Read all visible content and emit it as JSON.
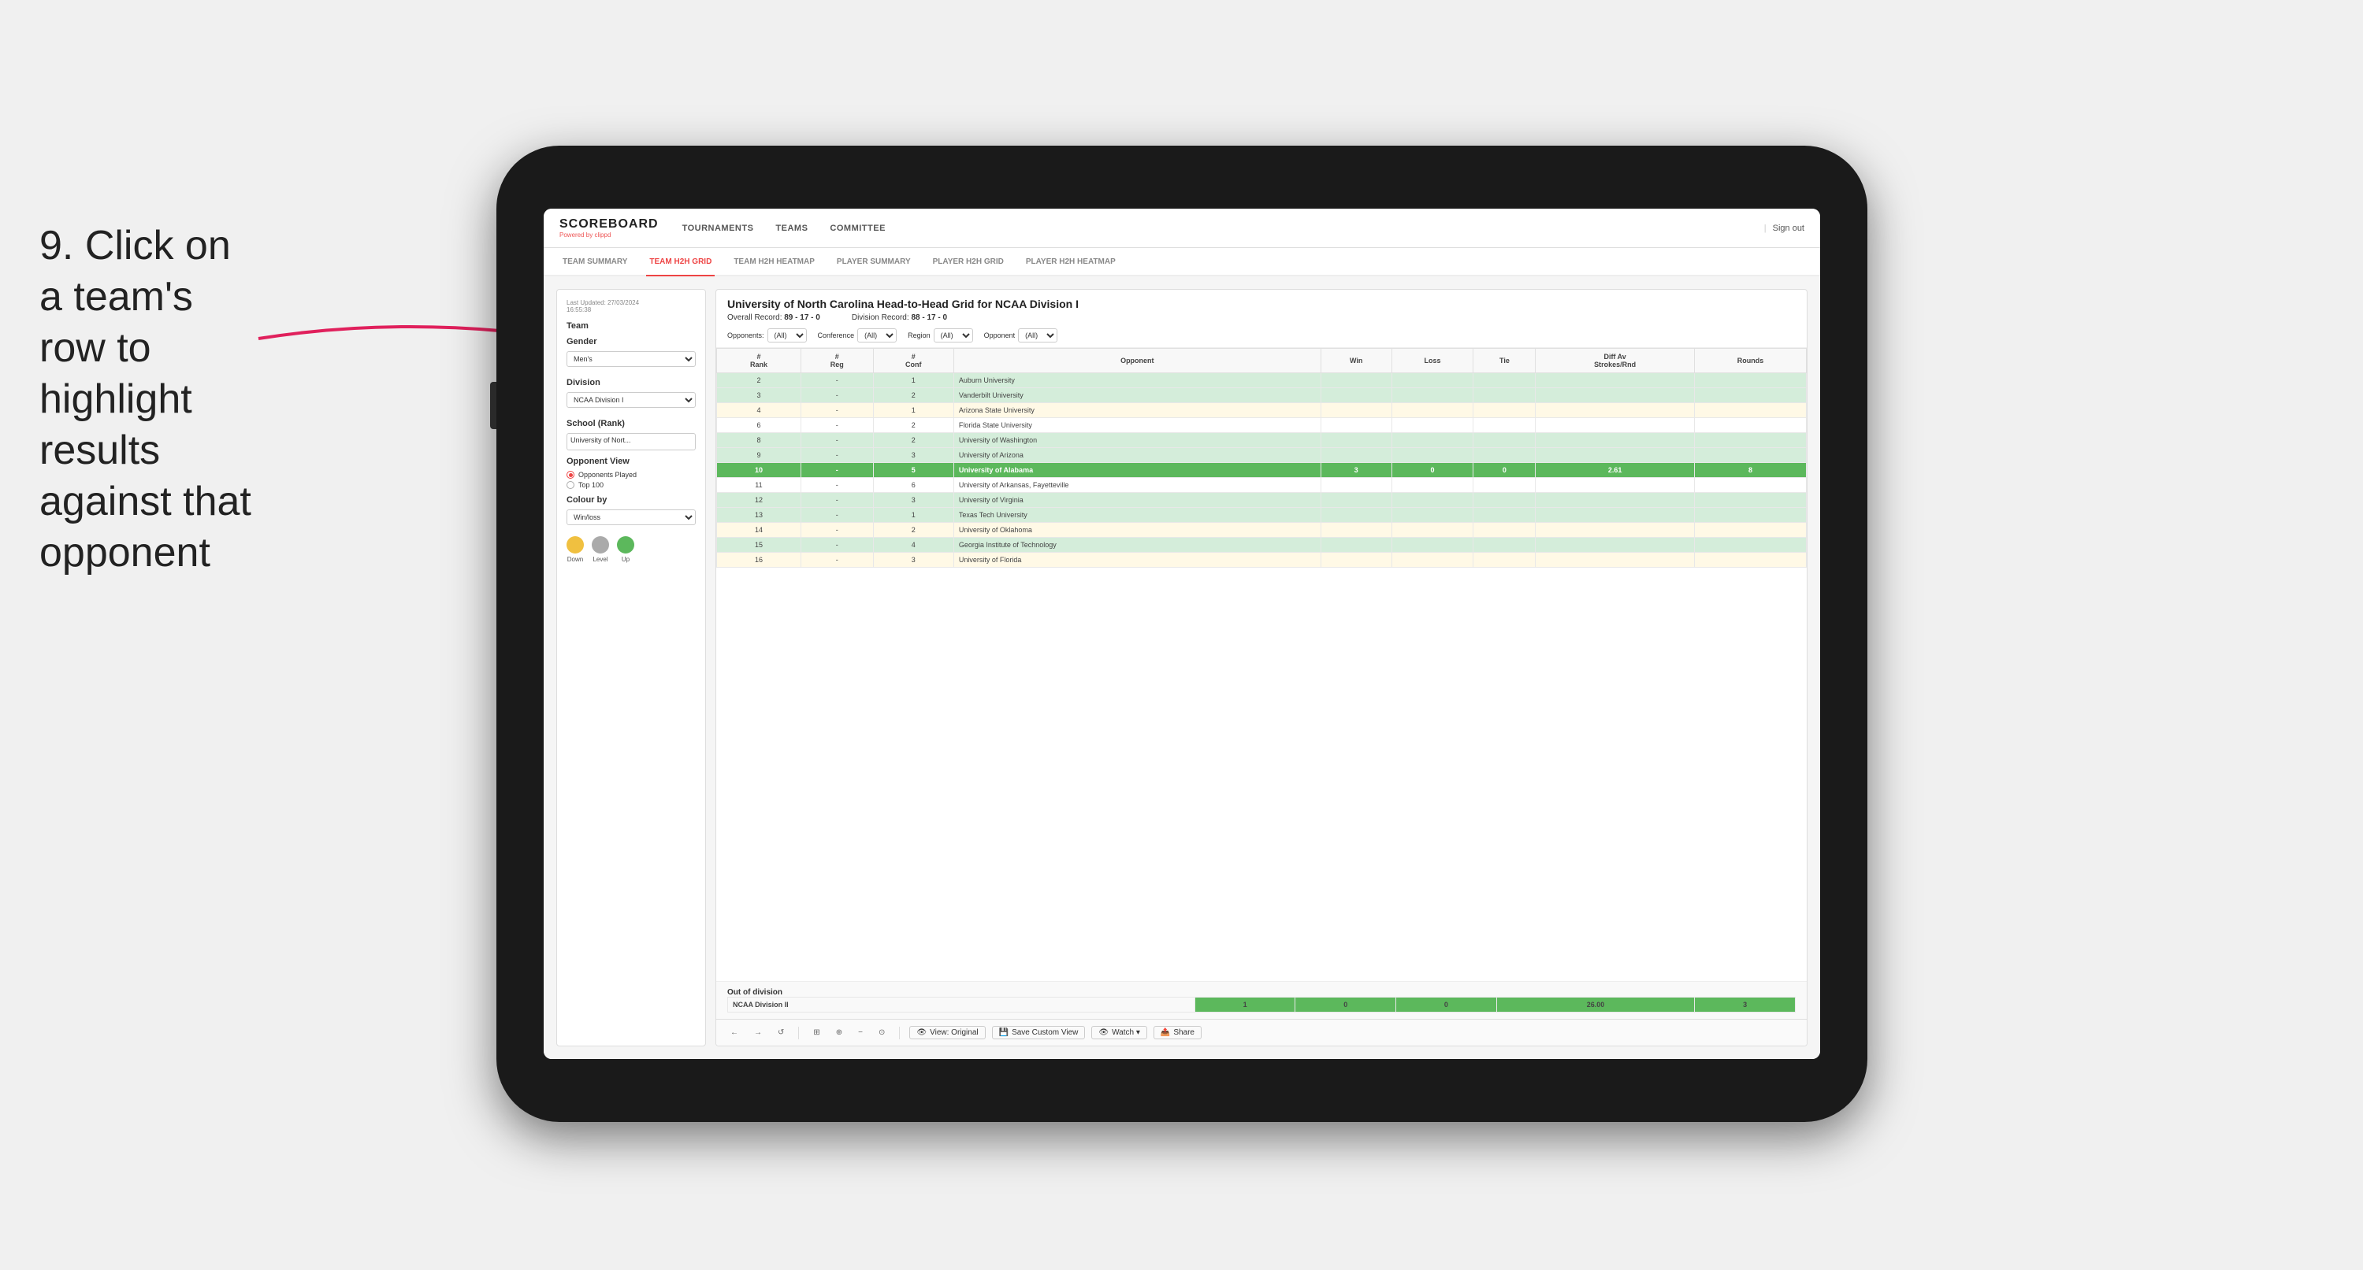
{
  "instruction": {
    "step": "9.",
    "text": "Click on a team's row to highlight results against that opponent"
  },
  "logo": {
    "scoreboard": "SCOREBOARD",
    "powered_by": "Powered by",
    "brand": "clippd"
  },
  "nav": {
    "items": [
      "TOURNAMENTS",
      "TEAMS",
      "COMMITTEE"
    ],
    "sign_out": "Sign out"
  },
  "sub_nav": {
    "tabs": [
      "TEAM SUMMARY",
      "TEAM H2H GRID",
      "TEAM H2H HEATMAP",
      "PLAYER SUMMARY",
      "PLAYER H2H GRID",
      "PLAYER H2H HEATMAP"
    ],
    "active": "TEAM H2H GRID"
  },
  "sidebar": {
    "last_updated_label": "Last Updated: 27/03/2024",
    "time": "16:55:38",
    "team_label": "Team",
    "gender_label": "Gender",
    "gender_value": "Men's",
    "division_label": "Division",
    "division_value": "NCAA Division I",
    "school_label": "School (Rank)",
    "school_value": "University of Nort...",
    "opponent_view_label": "Opponent View",
    "radio_options": [
      "Opponents Played",
      "Top 100"
    ],
    "radio_selected": "Opponents Played",
    "colour_by_label": "Colour by",
    "colour_by_value": "Win/loss",
    "legend": [
      {
        "label": "Down",
        "color": "#f0c040"
      },
      {
        "label": "Level",
        "color": "#aaaaaa"
      },
      {
        "label": "Up",
        "color": "#5cb85c"
      }
    ]
  },
  "grid": {
    "title": "University of North Carolina Head-to-Head Grid for NCAA Division I",
    "overall_record_label": "Overall Record:",
    "overall_record": "89 - 17 - 0",
    "division_record_label": "Division Record:",
    "division_record": "88 - 17 - 0",
    "filters": {
      "opponents_label": "Opponents:",
      "opponents_value": "(All)",
      "conference_label": "Conference",
      "conference_value": "(All)",
      "region_label": "Region",
      "region_value": "(All)",
      "opponent_label": "Opponent",
      "opponent_value": "(All)"
    },
    "columns": [
      "#\nRank",
      "#\nReg",
      "#\nConf",
      "Opponent",
      "Win",
      "Loss",
      "Tie",
      "Diff Av\nStrokes/Rnd",
      "Rounds"
    ],
    "rows": [
      {
        "rank": "2",
        "reg": "-",
        "conf": "1",
        "opponent": "Auburn University",
        "win": "",
        "loss": "",
        "tie": "",
        "diff": "",
        "rounds": "",
        "color": "light-green"
      },
      {
        "rank": "3",
        "reg": "-",
        "conf": "2",
        "opponent": "Vanderbilt University",
        "win": "",
        "loss": "",
        "tie": "",
        "diff": "",
        "rounds": "",
        "color": "light-green"
      },
      {
        "rank": "4",
        "reg": "-",
        "conf": "1",
        "opponent": "Arizona State University",
        "win": "",
        "loss": "",
        "tie": "",
        "diff": "",
        "rounds": "",
        "color": "light-yellow"
      },
      {
        "rank": "6",
        "reg": "-",
        "conf": "2",
        "opponent": "Florida State University",
        "win": "",
        "loss": "",
        "tie": "",
        "diff": "",
        "rounds": "",
        "color": "white"
      },
      {
        "rank": "8",
        "reg": "-",
        "conf": "2",
        "opponent": "University of Washington",
        "win": "",
        "loss": "",
        "tie": "",
        "diff": "",
        "rounds": "",
        "color": "light-green"
      },
      {
        "rank": "9",
        "reg": "-",
        "conf": "3",
        "opponent": "University of Arizona",
        "win": "",
        "loss": "",
        "tie": "",
        "diff": "",
        "rounds": "",
        "color": "light-green"
      },
      {
        "rank": "10",
        "reg": "-",
        "conf": "5",
        "opponent": "University of Alabama",
        "win": "3",
        "loss": "0",
        "tie": "0",
        "diff": "2.61",
        "rounds": "8",
        "color": "selected",
        "highlight": true
      },
      {
        "rank": "11",
        "reg": "-",
        "conf": "6",
        "opponent": "University of Arkansas, Fayetteville",
        "win": "",
        "loss": "",
        "tie": "",
        "diff": "",
        "rounds": "",
        "color": "white"
      },
      {
        "rank": "12",
        "reg": "-",
        "conf": "3",
        "opponent": "University of Virginia",
        "win": "",
        "loss": "",
        "tie": "",
        "diff": "",
        "rounds": "",
        "color": "light-green"
      },
      {
        "rank": "13",
        "reg": "-",
        "conf": "1",
        "opponent": "Texas Tech University",
        "win": "",
        "loss": "",
        "tie": "",
        "diff": "",
        "rounds": "",
        "color": "light-green"
      },
      {
        "rank": "14",
        "reg": "-",
        "conf": "2",
        "opponent": "University of Oklahoma",
        "win": "",
        "loss": "",
        "tie": "",
        "diff": "",
        "rounds": "",
        "color": "light-yellow"
      },
      {
        "rank": "15",
        "reg": "-",
        "conf": "4",
        "opponent": "Georgia Institute of Technology",
        "win": "",
        "loss": "",
        "tie": "",
        "diff": "",
        "rounds": "",
        "color": "light-green"
      },
      {
        "rank": "16",
        "reg": "-",
        "conf": "3",
        "opponent": "University of Florida",
        "win": "",
        "loss": "",
        "tie": "",
        "diff": "",
        "rounds": "",
        "color": "light-yellow"
      }
    ],
    "out_of_division": {
      "label": "Out of division",
      "row": {
        "name": "NCAA Division II",
        "win": "1",
        "loss": "0",
        "tie": "0",
        "diff": "26.00",
        "rounds": "3"
      }
    }
  },
  "toolbar": {
    "buttons": [
      "←",
      "→",
      "↺",
      "⊞",
      "⊕",
      "−",
      "+",
      "⊙"
    ],
    "view_original": "View: Original",
    "save_custom_view": "Save Custom View",
    "watch": "Watch ▾",
    "share": "Share"
  }
}
